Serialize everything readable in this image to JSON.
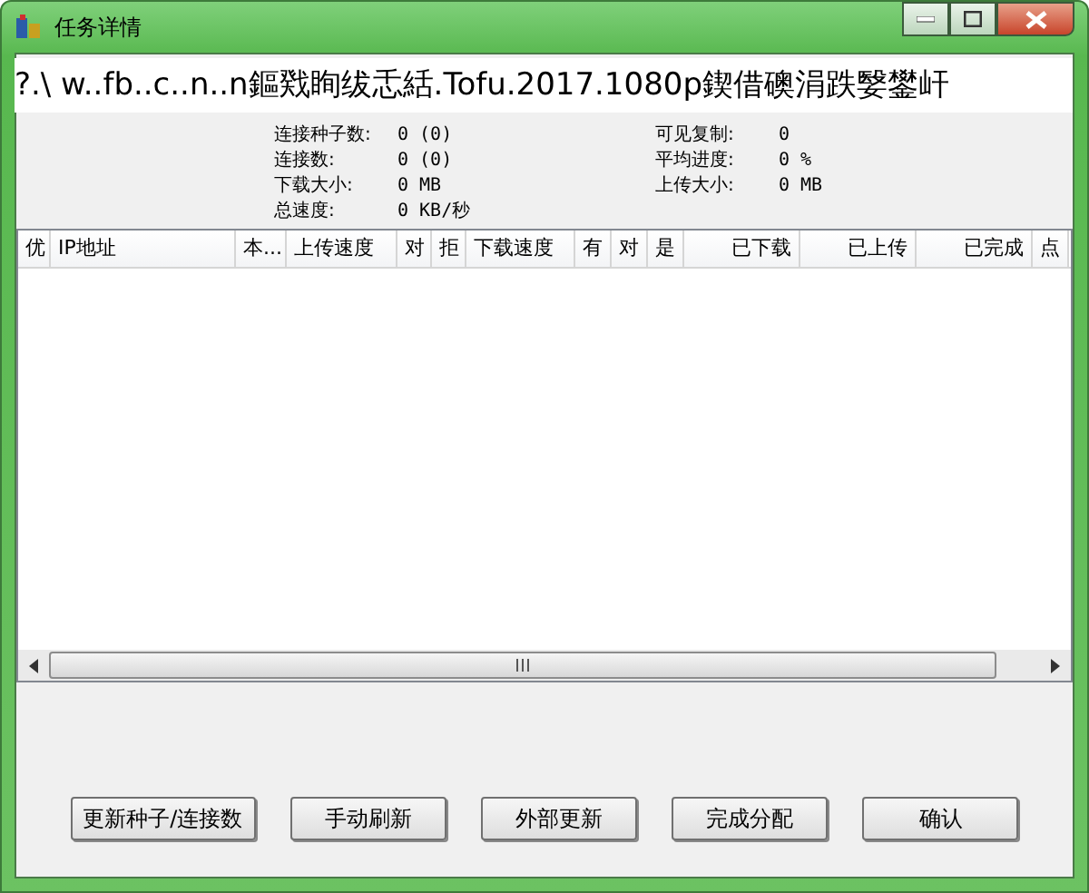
{
  "window": {
    "title": "任务详情"
  },
  "file_name": "?.\\ w..fb..c..n..n鏂戣眴绂忎絬.Tofu.2017.1080p鍥借礇涓跌嫛鐢屽",
  "stats_left": [
    {
      "label": "连接种子数:",
      "value": "0 (0)"
    },
    {
      "label": "连接数:",
      "value": "0 (0)"
    },
    {
      "label": "下载大小:",
      "value": "0 MB"
    },
    {
      "label": "总速度:",
      "value": "0 KB/秒"
    }
  ],
  "stats_right": [
    {
      "label": "可见复制:",
      "value": "0"
    },
    {
      "label": "平均进度:",
      "value": "0 %"
    },
    {
      "label": "上传大小:",
      "value": "0 MB"
    }
  ],
  "table": {
    "columns": [
      "优",
      "IP地址",
      "本...",
      "上传速度",
      "对",
      "拒",
      "下载速度",
      "有",
      "对",
      "是",
      "已下载",
      "已上传",
      "已完成",
      "点"
    ]
  },
  "buttons": [
    "更新种子/连接数",
    "手动刷新",
    "外部更新",
    "完成分配",
    "确认"
  ]
}
